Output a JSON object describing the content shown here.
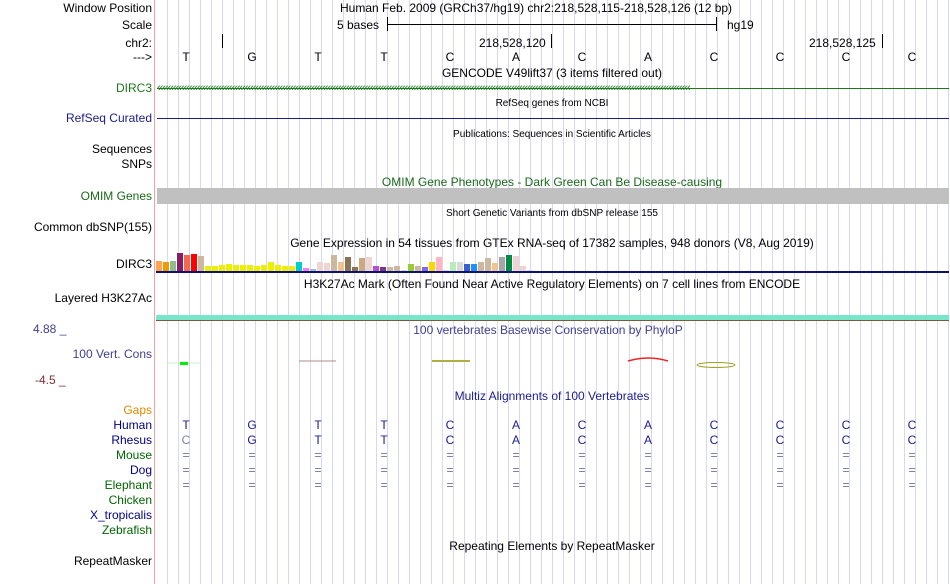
{
  "header": {
    "window_position_label": "Window Position",
    "scale_label": "Scale",
    "chr_label": "chr2:",
    "strand_label": "--->",
    "assembly_title": "Human Feb. 2009 (GRCh37/hg19)   chr2:218,528,115-218,528,126 (12 bp)",
    "scale_text": "5 bases",
    "scale_db": "hg19",
    "coord_1": "218,528,120",
    "coord_2": "218,528,125"
  },
  "bases": [
    "T",
    "G",
    "T",
    "T",
    "C",
    "A",
    "C",
    "A",
    "C",
    "C",
    "C",
    "C"
  ],
  "tracks": {
    "gencode_title": "GENCODE V49lift37 (3 items filtered out)",
    "gencode_gene": "DIRC3",
    "refseq_title": "RefSeq genes from NCBI",
    "refseq_label": "RefSeq Curated",
    "pubs_title": "Publications: Sequences in Scientific Articles",
    "sequences_label": "Sequences",
    "snps_label": "SNPs",
    "omim_title": "OMIM Gene Phenotypes - Dark Green Can Be Disease-causing",
    "omim_label": "OMIM Genes",
    "dbsnp_title": "Short Genetic Variants from dbSNP release 155",
    "dbsnp_label": "Common dbSNP(155)",
    "gtex_title": "Gene Expression in 54 tissues from GTEx RNA-seq of 17382 samples, 948 donors (V8, Aug 2019)",
    "gtex_label": "DIRC3",
    "h3k_title": "H3K27Ac Mark (Often Found Near Active Regulatory Elements) on 7 cell lines from ENCODE",
    "h3k_label": "Layered H3K27Ac",
    "phylop_title": "100 vertebrates Basewise Conservation by PhyloP",
    "phylop_label": "100 Vert. Cons",
    "phylop_max": "4.88 _",
    "phylop_min": "-4.5 _",
    "multiz_title": "Multiz Alignments of 100 Vertebrates",
    "repeat_title": "Repeating Elements by RepeatMasker",
    "repeat_label": "RepeatMasker"
  },
  "multiz": {
    "species": [
      {
        "name": "Gaps",
        "color": "#e08a00"
      },
      {
        "name": "Human",
        "color": "#000080",
        "bases": [
          "T",
          "G",
          "T",
          "T",
          "C",
          "A",
          "C",
          "A",
          "C",
          "C",
          "C",
          "C"
        ]
      },
      {
        "name": "Rhesus",
        "color": "#000080",
        "bases": [
          "C",
          "G",
          "T",
          "T",
          "C",
          "A",
          "C",
          "A",
          "C",
          "C",
          "C",
          "C"
        ]
      },
      {
        "name": "Mouse",
        "color": "#006400",
        "bases": [
          "=",
          "=",
          "=",
          "=",
          "=",
          "=",
          "=",
          "=",
          "=",
          "=",
          "=",
          "="
        ]
      },
      {
        "name": "Dog",
        "color": "#000080",
        "bases": [
          "=",
          "=",
          "=",
          "=",
          "=",
          "=",
          "=",
          "=",
          "=",
          "=",
          "=",
          "="
        ]
      },
      {
        "name": "Elephant",
        "color": "#006400",
        "bases": [
          "=",
          "=",
          "=",
          "=",
          "=",
          "=",
          "=",
          "=",
          "=",
          "=",
          "=",
          "="
        ]
      },
      {
        "name": "Chicken",
        "color": "#006400"
      },
      {
        "name": "X_tropicalis",
        "color": "#000080"
      },
      {
        "name": "Zebrafish",
        "color": "#006400"
      }
    ]
  },
  "gtex_bars": [
    {
      "v": 10,
      "c": "#ffa54f"
    },
    {
      "v": 9,
      "c": "#ee9a00"
    },
    {
      "v": 10,
      "c": "#8fbc8f"
    },
    {
      "v": 18,
      "c": "#8b1c62"
    },
    {
      "v": 16,
      "c": "#ee6a50"
    },
    {
      "v": 17,
      "c": "#ff0000"
    },
    {
      "v": 15,
      "c": "#cdb79e"
    },
    {
      "v": 5,
      "c": "#eeee00"
    },
    {
      "v": 5,
      "c": "#eeee00"
    },
    {
      "v": 6,
      "c": "#eeee00"
    },
    {
      "v": 7,
      "c": "#eeee00"
    },
    {
      "v": 6,
      "c": "#eeee00"
    },
    {
      "v": 6,
      "c": "#eeee00"
    },
    {
      "v": 6,
      "c": "#eeee00"
    },
    {
      "v": 5,
      "c": "#eeee00"
    },
    {
      "v": 6,
      "c": "#eeee00"
    },
    {
      "v": 9,
      "c": "#eeee00"
    },
    {
      "v": 6,
      "c": "#eeee00"
    },
    {
      "v": 5,
      "c": "#eeee00"
    },
    {
      "v": 5,
      "c": "#eeee00"
    },
    {
      "v": 9,
      "c": "#00cdcd"
    },
    {
      "v": 3,
      "c": "#ee82ee"
    },
    {
      "v": 2,
      "c": "#9ac0cd"
    },
    {
      "v": 9,
      "c": "#eed5d2"
    },
    {
      "v": 8,
      "c": "#eed5d2"
    },
    {
      "v": 16,
      "c": "#cdb79e"
    },
    {
      "v": 9,
      "c": "#eec591"
    },
    {
      "v": 14,
      "c": "#8b7355"
    },
    {
      "v": 4,
      "c": "#8b7355"
    },
    {
      "v": 13,
      "c": "#cdaa7d"
    },
    {
      "v": 14,
      "c": "#eed5d2"
    },
    {
      "v": 5,
      "c": "#b452cd"
    },
    {
      "v": 4,
      "c": "#7a378b"
    },
    {
      "v": 4,
      "c": "#cdb79e"
    },
    {
      "v": 5,
      "c": "#cdb79e"
    },
    {
      "v": 1,
      "c": "#d9d9d9"
    },
    {
      "v": 7,
      "c": "#9acd32"
    },
    {
      "v": 5,
      "c": "#cdb79e"
    },
    {
      "v": 4,
      "c": "#7b68ee"
    },
    {
      "v": 9,
      "c": "#ffd700"
    },
    {
      "v": 14,
      "c": "#ffb6c1"
    },
    {
      "v": 1,
      "c": "#d9d9d9"
    },
    {
      "v": 9,
      "c": "#b4eeb4"
    },
    {
      "v": 9,
      "c": "#d9d9d9"
    },
    {
      "v": 7,
      "c": "#3a5fcd"
    },
    {
      "v": 7,
      "c": "#1e90ff"
    },
    {
      "v": 9,
      "c": "#cdb79e"
    },
    {
      "v": 13,
      "c": "#cdb79e"
    },
    {
      "v": 8,
      "c": "#eec591"
    },
    {
      "v": 14,
      "c": "#a6a6a6"
    },
    {
      "v": 16,
      "c": "#008b45"
    },
    {
      "v": 15,
      "c": "#eed5d2"
    },
    {
      "v": 5,
      "c": "#eed5d2"
    },
    {
      "v": 1,
      "c": "#d9d9d9"
    }
  ]
}
